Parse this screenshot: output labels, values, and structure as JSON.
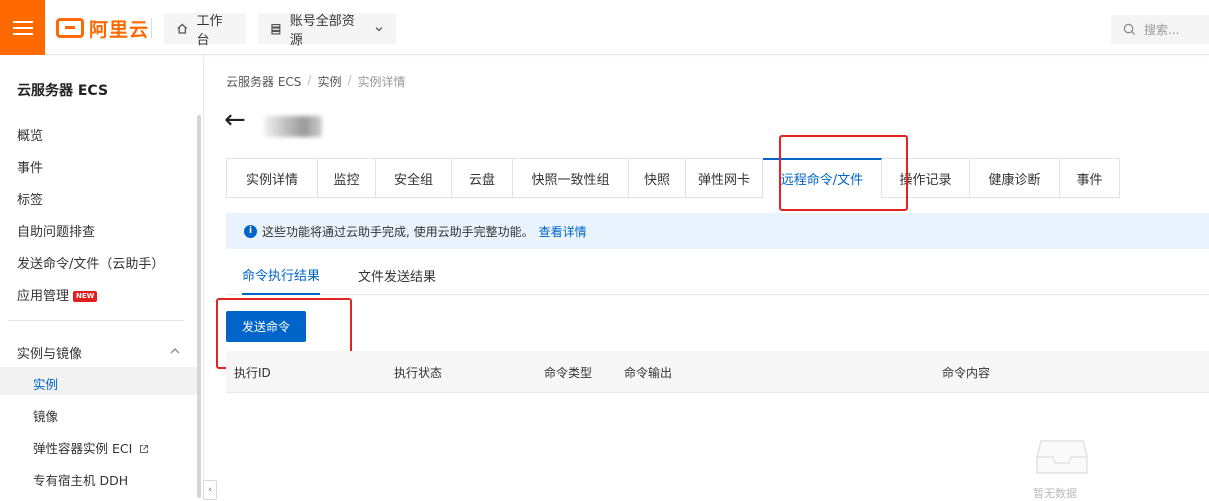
{
  "header": {
    "logo_text": "阿里云",
    "workbench_label": "工作台",
    "account_label": "账号全部资源",
    "search_placeholder": "搜索..."
  },
  "sidebar": {
    "title": "云服务器 ECS",
    "items": [
      "概览",
      "事件",
      "标签",
      "自助问题排查",
      "发送命令/文件（云助手）",
      "应用管理"
    ],
    "new_badge": "NEW",
    "section_title": "实例与镜像",
    "sub_items": [
      "实例",
      "镜像",
      "弹性容器实例 ECI",
      "专有宿主机 DDH"
    ]
  },
  "breadcrumb": [
    "云服务器 ECS",
    "实例",
    "实例详情"
  ],
  "tabs": [
    "实例详情",
    "监控",
    "安全组",
    "云盘",
    "快照一致性组",
    "快照",
    "弹性网卡",
    "远程命令/文件",
    "操作记录",
    "健康诊断",
    "事件"
  ],
  "active_tab": "远程命令/文件",
  "notice": {
    "text": "这些功能将通过云助手完成, 使用云助手完整功能。",
    "link": "查看详情"
  },
  "subtabs": [
    "命令执行结果",
    "文件发送结果"
  ],
  "send_button": "发送命令",
  "table": {
    "columns": [
      "执行ID",
      "执行状态",
      "命令类型",
      "命令输出",
      "命令内容"
    ],
    "empty_text": "暂无数据"
  },
  "colors": {
    "brand": "#ff6a00",
    "primary": "#0064c8",
    "highlight": "#e32222"
  }
}
